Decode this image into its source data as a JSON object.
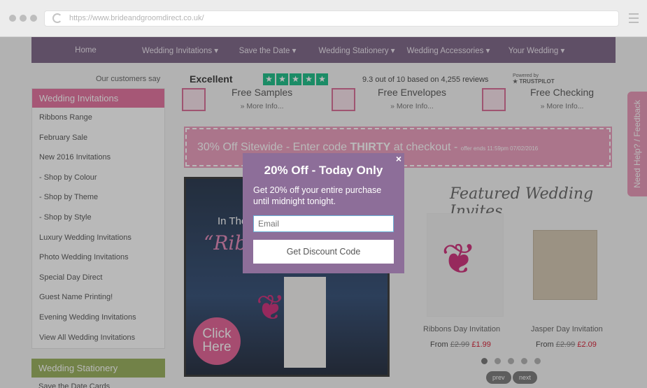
{
  "browser": {
    "url": "https://www.brideandgroomdirect.co.uk/"
  },
  "nav": {
    "items": [
      "Home",
      "Wedding Invitations ▾",
      "Save the Date ▾",
      "Wedding Stationery ▾",
      "Wedding Accessories ▾",
      "Your Wedding ▾"
    ]
  },
  "trust": {
    "customers_say": "Our customers say",
    "rating_word": "Excellent",
    "score_text": "9.3 out of 10 based on 4,255 reviews",
    "powered_by": "Powered by",
    "brand": "★ TRUSTPILOT"
  },
  "features": [
    {
      "title": "Free Samples",
      "more": "» More Info..."
    },
    {
      "title": "Free Envelopes",
      "more": "» More Info..."
    },
    {
      "title": "Free Checking",
      "more": "» More Info..."
    }
  ],
  "sidebar": {
    "heading": "Wedding Invitations",
    "items": [
      "Ribbons Range",
      "February Sale",
      "New 2016 Invitations",
      "- Shop by Colour",
      "- Shop by Theme",
      "- Shop by Style",
      "Luxury Wedding Invitations",
      "Photo Wedding Invitations",
      "Special Day Direct",
      "Guest Name Printing!",
      "Evening Wedding Invitations",
      "View All Wedding Invitations"
    ],
    "heading2": "Wedding Stationery",
    "after_item": "Save the Date Cards"
  },
  "banner": {
    "pre": "30% Off Sitewide - Enter code ",
    "code": "THIRTY",
    "post": " at checkout - ",
    "small": "offer ends 11:59pm 07/02/2016"
  },
  "hero": {
    "line1": "In The",
    "line2": "“Ribbon",
    "click": "Click Here"
  },
  "featured": {
    "title": "Featured Wedding Invites",
    "products": [
      {
        "name": "Ribbons Day Invitation",
        "from": "From ",
        "old": "£2.99",
        "new": "£1.99"
      },
      {
        "name": "Jasper Day Invitation",
        "from": "From ",
        "old": "£2.99",
        "new": "£2.09"
      }
    ],
    "prev": "prev",
    "next": "next"
  },
  "feedback": "Need Help? / Feedback",
  "modal": {
    "close": "×",
    "title": "20% Off - Today Only",
    "desc": "Get 20% off your entire purchase until midnight tonight.",
    "email_placeholder": "Email",
    "button": "Get Discount Code"
  }
}
